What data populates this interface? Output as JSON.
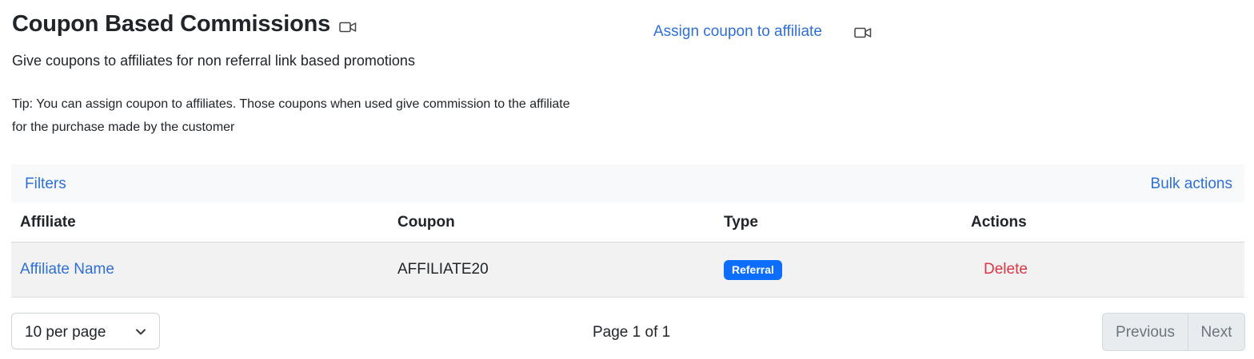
{
  "header": {
    "title": "Coupon Based Commissions",
    "subtitle": "Give coupons to affiliates for non referral link based promotions",
    "tip": "Tip: You can assign coupon to affiliates. Those coupons when used give commission to the affiliate for the purchase made by the customer",
    "title_icon": "video-camera-icon"
  },
  "actions": {
    "assign_label": "Assign coupon to affiliate",
    "assign_icon": "video-camera-icon"
  },
  "toolbar": {
    "filters_label": "Filters",
    "bulk_actions_label": "Bulk actions"
  },
  "table": {
    "columns": [
      "Affiliate",
      "Coupon",
      "Type",
      "Actions"
    ],
    "rows": [
      {
        "affiliate": "Affiliate Name",
        "coupon": "AFFILIATE20",
        "type": "Referral",
        "action": "Delete"
      }
    ]
  },
  "pagination": {
    "per_page_label": "10 per page",
    "page_info": "Page 1 of 1",
    "previous_label": "Previous",
    "next_label": "Next"
  },
  "colors": {
    "link": "#2f6fd6",
    "badge": "#0d6efd",
    "danger": "#dc3545",
    "toolbar_bg": "#f8f9fa",
    "row_bg": "#f2f2f2"
  }
}
